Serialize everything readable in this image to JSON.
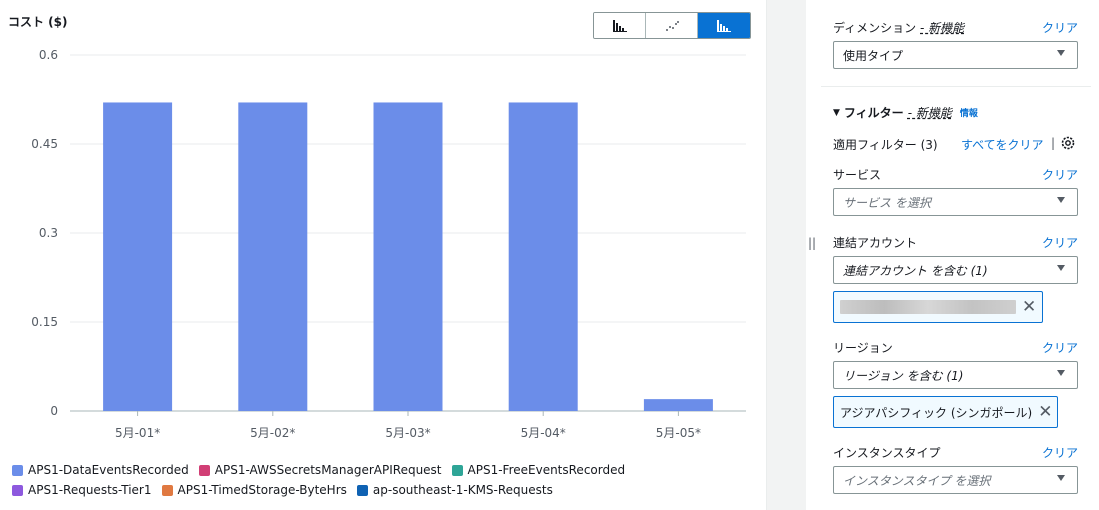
{
  "chart": {
    "ylabel": "コスト ($)",
    "view_buttons": [
      {
        "icon": "bar-chart-icon",
        "active": false
      },
      {
        "icon": "line-chart-icon",
        "active": false
      },
      {
        "icon": "stacked-bar-chart-icon",
        "active": true
      }
    ],
    "legend": [
      {
        "label": "APS1-DataEventsRecorded",
        "color": "#6b8de9"
      },
      {
        "label": "APS1-AWSSecretsManagerAPIRequest",
        "color": "#d13e75"
      },
      {
        "label": "APS1-FreeEventsRecorded",
        "color": "#2ea597"
      },
      {
        "label": "APS1-Requests-Tier1",
        "color": "#8d59de"
      },
      {
        "label": "APS1-TimedStorage-ByteHrs",
        "color": "#e07941"
      },
      {
        "label": "ap-southeast-1-KMS-Requests",
        "color": "#0f62b3"
      }
    ]
  },
  "chart_data": {
    "type": "bar",
    "ylabel": "コスト ($)",
    "categories": [
      "5月-01*",
      "5月-02*",
      "5月-03*",
      "5月-04*",
      "5月-05*"
    ],
    "series": [
      {
        "name": "APS1-DataEventsRecorded",
        "values": [
          0.52,
          0.52,
          0.52,
          0.52,
          0.02
        ]
      }
    ],
    "yticks": [
      0,
      0.15,
      0.3,
      0.45,
      0.6
    ],
    "ytick_labels": [
      "0",
      "0.15",
      "0.3",
      "0.45",
      "0.6"
    ],
    "ylim": [
      0,
      0.6
    ],
    "grid": true,
    "legend_position": "bottom"
  },
  "panel": {
    "dimension": {
      "label": "ディメンション",
      "new_tag": "- 新機能",
      "clear": "クリア",
      "value": "使用タイプ"
    },
    "filters": {
      "title": "フィルター",
      "new_tag": "- 新機能",
      "info": "情報",
      "applied": "適用フィルター (3)",
      "clear_all": "すべてをクリア",
      "separator": "|"
    },
    "service": {
      "label": "サービス",
      "clear": "クリア",
      "placeholder": "サービス を選択"
    },
    "linked_account": {
      "label": "連結アカウント",
      "clear": "クリア",
      "value": "連結アカウント を含む (1)"
    },
    "region": {
      "label": "リージョン",
      "clear": "クリア",
      "value": "リージョン を含む (1)",
      "token": "アジアパシフィック (シンガポール)"
    },
    "instance_type": {
      "label": "インスタンスタイプ",
      "clear": "クリア",
      "placeholder": "インスタンスタイプ を選択"
    }
  }
}
